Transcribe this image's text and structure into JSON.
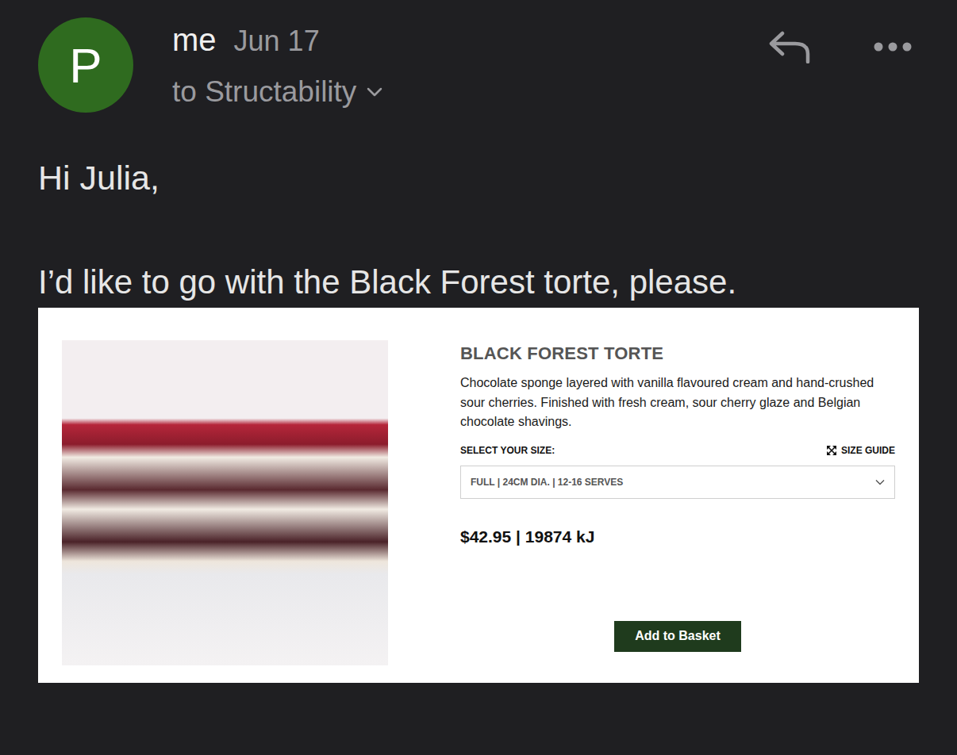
{
  "email": {
    "avatar": "P",
    "sender": "me",
    "date": "Jun 17",
    "recipient": "to Structability",
    "greeting": "Hi Julia,",
    "body": "I’d like to go with the Black Forest torte, please."
  },
  "product": {
    "title": "BLACK FOREST TORTE",
    "description": "Chocolate sponge layered with vanilla flavoured cream and hand-crushed sour cherries. Finished with fresh cream, sour cherry glaze and Belgian chocolate shavings.",
    "size_label": "SELECT YOUR SIZE:",
    "size_guide": "SIZE GUIDE",
    "size_select": "FULL | 24CM DIA. | 12-16 SERVES",
    "price": "$42.95 | 19874 kJ",
    "button": "Add to Basket"
  }
}
